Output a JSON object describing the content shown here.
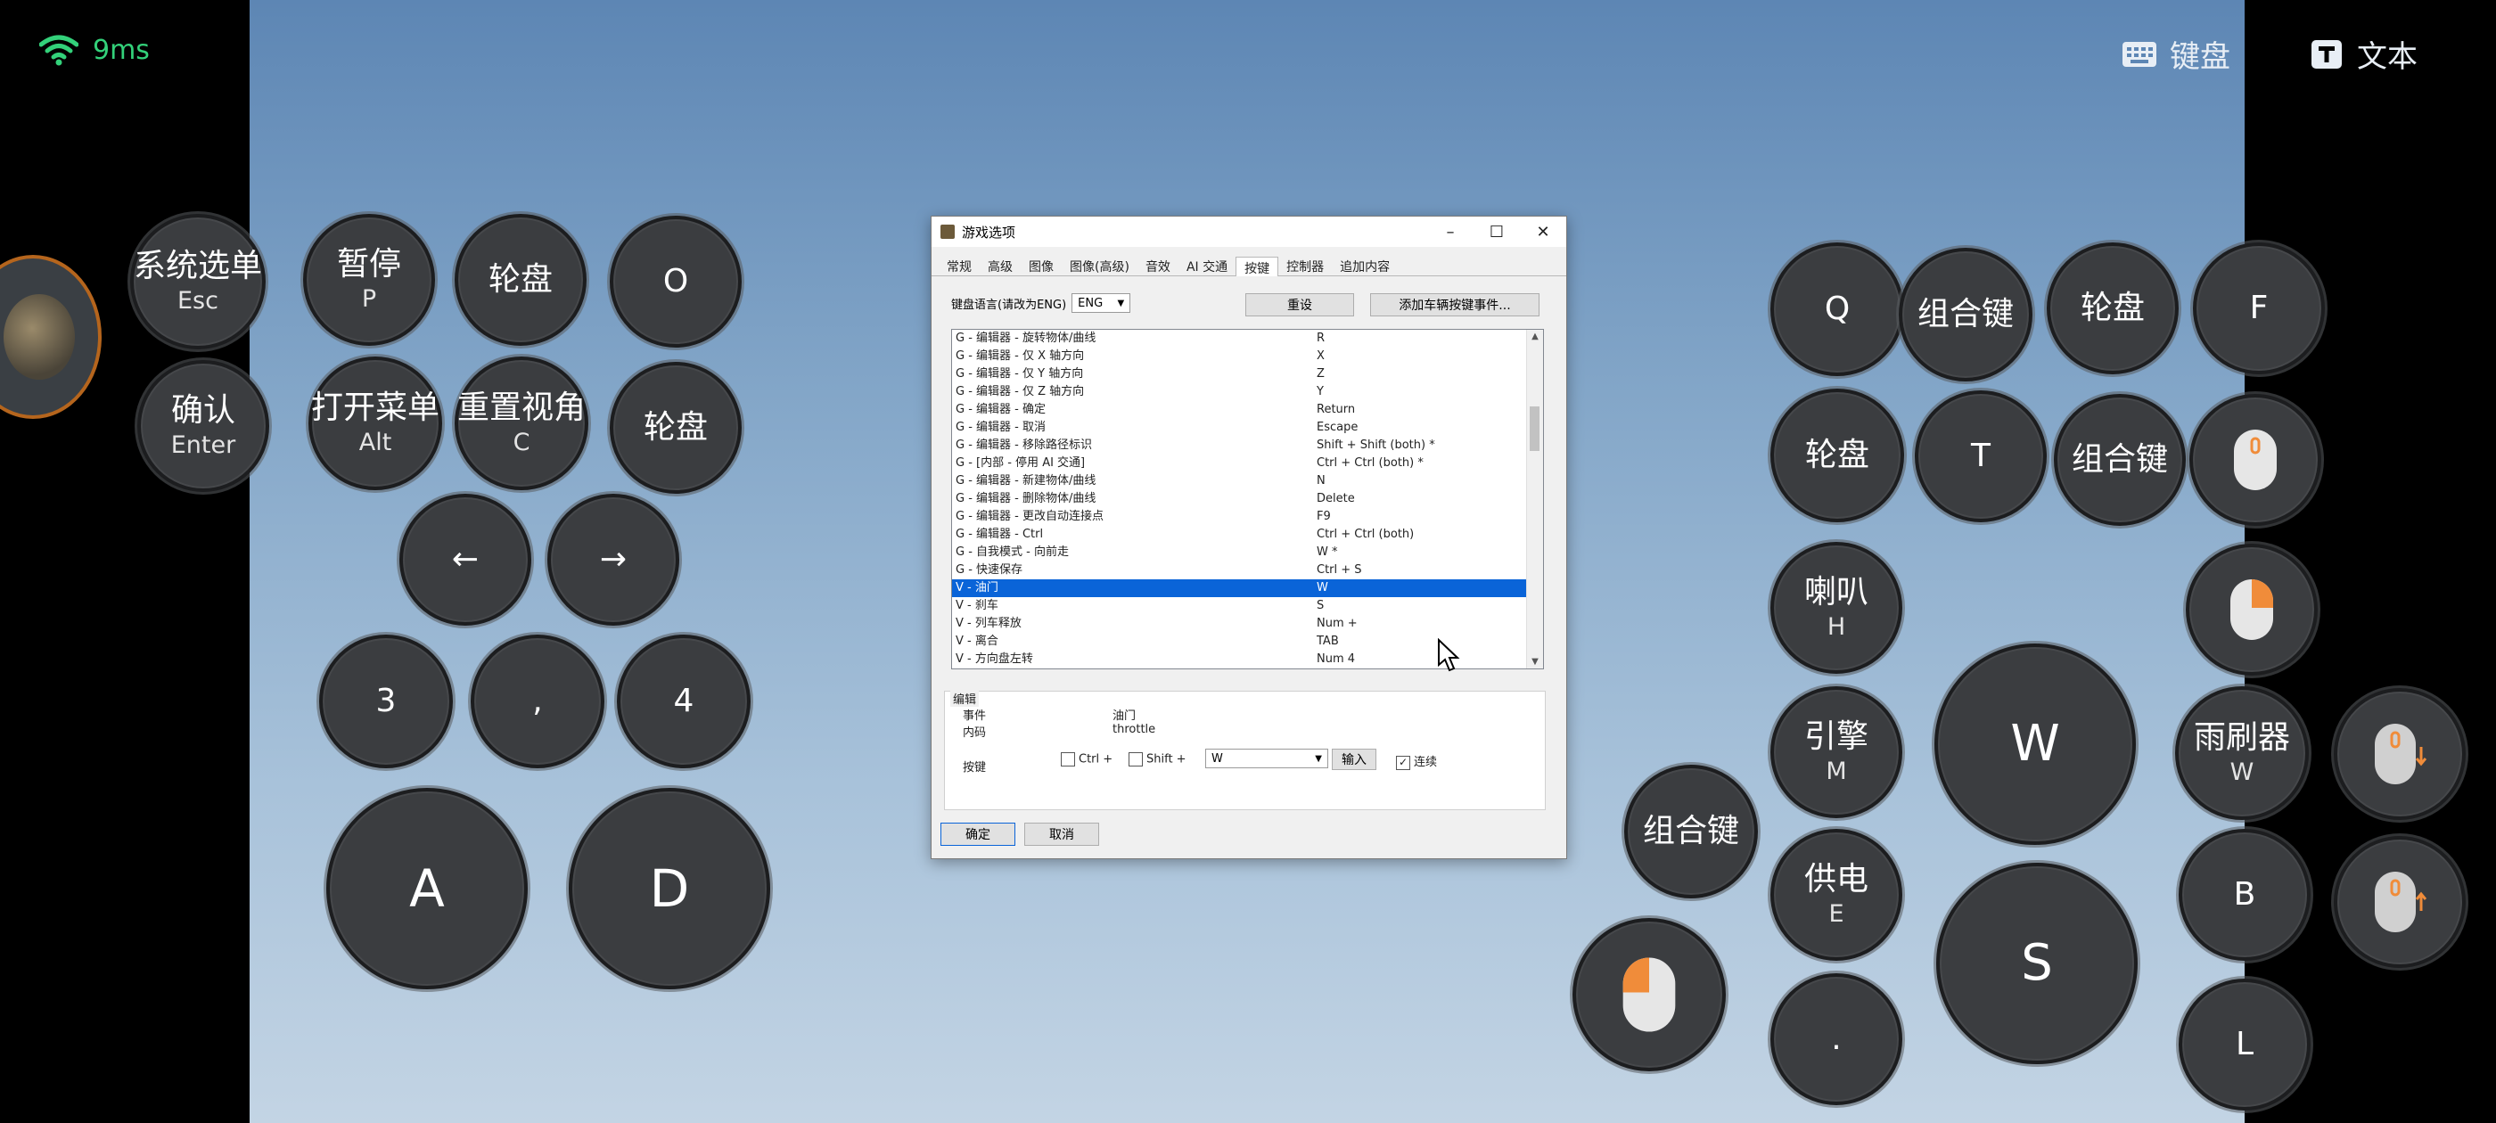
{
  "status": {
    "latency": "9ms"
  },
  "topbar": {
    "keyboard_label": "键盘",
    "text_label": "文本"
  },
  "left_keys": [
    {
      "id": "esc",
      "main": "系统选单",
      "sub": "Esc"
    },
    {
      "id": "pause",
      "main": "暂停",
      "sub": "P"
    },
    {
      "id": "wheel1",
      "main": "轮盘",
      "sub": ""
    },
    {
      "id": "o",
      "main": "O",
      "sub": ""
    },
    {
      "id": "enter",
      "main": "确认",
      "sub": "Enter"
    },
    {
      "id": "alt",
      "main": "打开菜单",
      "sub": "Alt"
    },
    {
      "id": "c",
      "main": "重置视角",
      "sub": "C"
    },
    {
      "id": "wheel2",
      "main": "轮盘",
      "sub": ""
    },
    {
      "id": "left",
      "main": "←",
      "sub": ""
    },
    {
      "id": "right",
      "main": "→",
      "sub": ""
    },
    {
      "id": "k3",
      "main": "3",
      "sub": ""
    },
    {
      "id": "comma",
      "main": ",",
      "sub": ""
    },
    {
      "id": "k4",
      "main": "4",
      "sub": ""
    },
    {
      "id": "a",
      "main": "A",
      "sub": ""
    },
    {
      "id": "d",
      "main": "D",
      "sub": ""
    }
  ],
  "right_keys": [
    {
      "id": "q",
      "main": "Q",
      "sub": ""
    },
    {
      "id": "combo1",
      "main": "组合键",
      "sub": ""
    },
    {
      "id": "wheel3",
      "main": "轮盘",
      "sub": ""
    },
    {
      "id": "f",
      "main": "F",
      "sub": ""
    },
    {
      "id": "wheel4",
      "main": "轮盘",
      "sub": ""
    },
    {
      "id": "t",
      "main": "T",
      "sub": ""
    },
    {
      "id": "combo2",
      "main": "组合键",
      "sub": ""
    },
    {
      "id": "horn",
      "main": "喇叭",
      "sub": "H"
    },
    {
      "id": "engine",
      "main": "引擎",
      "sub": "M"
    },
    {
      "id": "w",
      "main": "W",
      "sub": ""
    },
    {
      "id": "wiper",
      "main": "雨刷器",
      "sub": "W"
    },
    {
      "id": "combo3",
      "main": "组合键",
      "sub": ""
    },
    {
      "id": "power",
      "main": "供电",
      "sub": "E"
    },
    {
      "id": "b",
      "main": "B",
      "sub": ""
    },
    {
      "id": "s",
      "main": "S",
      "sub": ""
    },
    {
      "id": "dot",
      "main": ".",
      "sub": ""
    },
    {
      "id": "l",
      "main": "L",
      "sub": ""
    }
  ],
  "dialog": {
    "title": "游戏选项",
    "tabs": [
      "常规",
      "高级",
      "图像",
      "图像(高级)",
      "音效",
      "AI 交通",
      "按键",
      "控制器",
      "追加内容"
    ],
    "active_tab": "按键",
    "lang_label": "键盘语言(请改为ENG)",
    "lang_value": "ENG",
    "reset_label": "重设",
    "add_label": "添加车辆按键事件...",
    "rows": [
      {
        "event": "G - 编辑器 - 旋转物体/曲线",
        "key": "R"
      },
      {
        "event": "G - 编辑器 - 仅 X 轴方向",
        "key": "X"
      },
      {
        "event": "G - 编辑器 - 仅 Y 轴方向",
        "key": "Z"
      },
      {
        "event": "G - 编辑器 - 仅 Z 轴方向",
        "key": "Y"
      },
      {
        "event": "G - 编辑器 - 确定",
        "key": "Return"
      },
      {
        "event": "G - 编辑器 - 取消",
        "key": "Escape"
      },
      {
        "event": "G - 编辑器 - 移除路径标识",
        "key": "Shift + Shift (both) *"
      },
      {
        "event": "G - [内部 - 停用 AI 交通]",
        "key": "Ctrl + Ctrl (both) *"
      },
      {
        "event": "G - 编辑器 - 新建物体/曲线",
        "key": "N"
      },
      {
        "event": "G - 编辑器 - 删除物体/曲线",
        "key": "Delete"
      },
      {
        "event": "G - 编辑器 - 更改自动连接点",
        "key": "F9"
      },
      {
        "event": "G - 编辑器 - Ctrl",
        "key": "Ctrl + Ctrl (both)"
      },
      {
        "event": "G - 自我模式 - 向前走",
        "key": "W *"
      },
      {
        "event": "G - 快速保存",
        "key": "Ctrl + S"
      },
      {
        "event": "V - 油门",
        "key": "W",
        "selected": true
      },
      {
        "event": "V - 刹车",
        "key": "S"
      },
      {
        "event": "V - 列车释放",
        "key": "Num +"
      },
      {
        "event": "V - 离合",
        "key": "TAB"
      },
      {
        "event": "V - 方向盘左转",
        "key": "Num 4"
      }
    ],
    "edit": {
      "group_label": "编辑",
      "event_label": "事件",
      "event_value": "油门",
      "code_label": "内码",
      "code_value": "throttle",
      "key_label": "按键",
      "ctrl_label": "Ctrl +",
      "shift_label": "Shift +",
      "key_value": "W",
      "input_label": "输入",
      "continuous_label": "连续"
    },
    "ok_label": "确定",
    "cancel_label": "取消"
  },
  "colors": {
    "accent": "#f08c3a",
    "signal": "#33d17a",
    "selection": "#0a64d8"
  }
}
